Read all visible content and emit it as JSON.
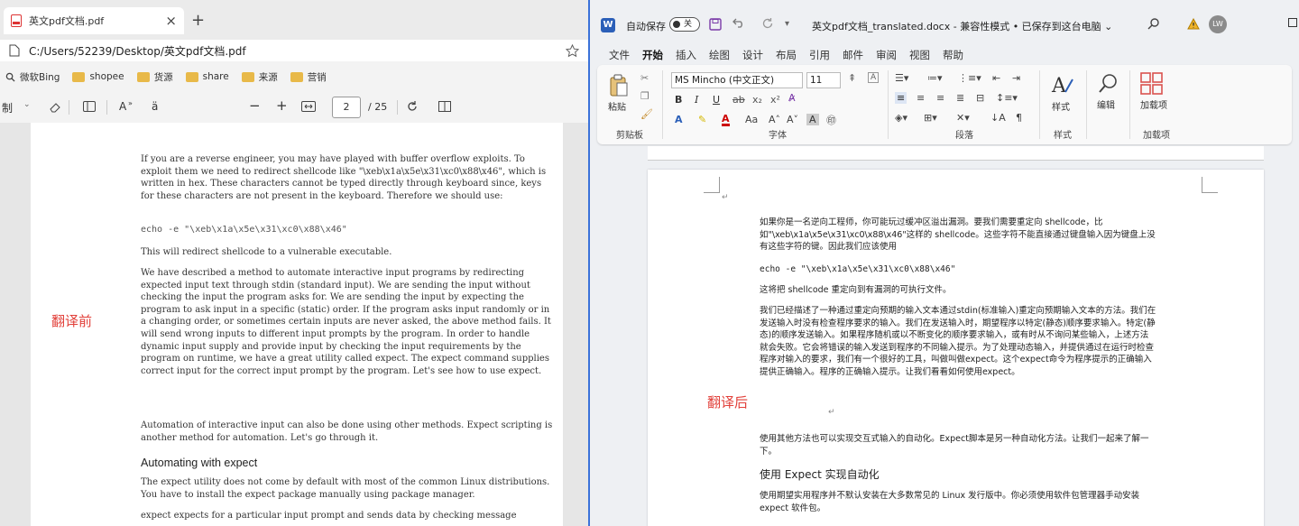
{
  "browser": {
    "tab_title": "英文pdf文档.pdf",
    "close_glyph": "×",
    "newtab_glyph": "+",
    "address": "C:/Users/52239/Desktop/英文pdf文档.pdf",
    "bookmarks": [
      "微软Bing",
      "shopee",
      "货源",
      "share",
      "来源",
      "营销"
    ]
  },
  "pdf_toolbar": {
    "draw_label": "制",
    "read_aloud_label": "A",
    "translate_label": "ä",
    "minus": "−",
    "plus": "+",
    "page_current": "2",
    "page_total": "/ 25"
  },
  "pdf": {
    "paragraphs": [
      "If you are a reverse engineer, you may have played with buffer overflow exploits. To exploit them we need to redirect shellcode like \"\\xeb\\x1a\\x5e\\x31\\xc0\\x88\\x46\", which is written in hex. These characters cannot be typed directly through keyboard since, keys for these characters are not present in the keyboard. Therefore we should use:",
      "echo -e \"\\xeb\\x1a\\x5e\\x31\\xc0\\x88\\x46\"",
      "This will redirect shellcode to a vulnerable executable.",
      "We have described a method to automate interactive input programs by redirecting expected input text through stdin (standard input). We are sending the input without checking the input the program asks for. We are sending the input by expecting the program to ask input in a specific (static) order. If the program asks input randomly or in a changing order, or sometimes certain inputs are never asked, the above method fails. It will send wrong inputs to different input prompts by the program. In order to handle dynamic input supply and provide input by checking the input requirements by the program on runtime, we have a great utility called expect. The expect command supplies correct input for the correct input prompt by the program. Let's see how to use expect.",
      "Automation of interactive input can also be done using other methods. Expect scripting is another method for automation. Let's go through it.",
      "Automating with expect",
      "The expect utility does not come by default with most of the common Linux distributions. You have to install the expect package manually using package manager.",
      "expect expects for a particular input prompt and sends data by checking message"
    ],
    "before_label": "翻译前"
  },
  "word": {
    "logo": "W",
    "autosave_label": "自动保存",
    "autosave_state": "关",
    "doc_title": "英文pdf文档_translated.docx  -  兼容性模式 • 已保存到这台电脑 ⌄",
    "user_initials": "LW",
    "menus": [
      "文件",
      "开始",
      "插入",
      "绘图",
      "设计",
      "布局",
      "引用",
      "邮件",
      "审阅",
      "视图",
      "帮助"
    ],
    "ribbon": {
      "paste_label": "粘贴",
      "clipboard_label": "剪贴板",
      "font_name": "MS Mincho (中文正文)",
      "font_size": "11",
      "font_label": "字体",
      "paragraph_label": "段落",
      "style_button": "样式",
      "styles_label": "样式",
      "edit_button": "编辑",
      "addin_button": "加载项",
      "addins_label": "加载项"
    },
    "paragraphs": [
      "如果你是一名逆向工程师，你可能玩过缓冲区溢出漏洞。要我们需要重定向 shellcode，比如\"\\xeb\\x1a\\x5e\\x31\\xc0\\x88\\x46\"这样的 shellcode。这些字符不能直接通过键盘输入因为键盘上没有这些字符的键。因此我们应该使用",
      "echo -e \"\\xeb\\x1a\\x5e\\x31\\xc0\\x88\\x46\"",
      "这将把 shellcode 重定向到有漏洞的可执行文件。",
      "我们已经描述了一种通过重定向预期的输入文本通过stdin(标准输入)重定向预期输入文本的方法。我们在发送输入时没有检查程序要求的输入。我们在发送输入时，期望程序以特定(静态)顺序要求输入。特定(静态)的顺序发送输入。如果程序随机或以不断变化的顺序要求输入，或有时从不询问某些输入，上述方法就会失败。它会将错误的输入发送到程序的不同输入提示。为了处理动态输入，并提供通过在运行时检查程序对输入的要求，我们有一个很好的工具，叫做叫做expect。这个expect命令为程序提示的正确输入提供正确输入。程序的正确输入提示。让我们看看如何使用expect。",
      "使用其他方法也可以实现交互式输入的自动化。Expect脚本是另一种自动化方法。让我们一起来了解一下。",
      "使用 Expect 实现自动化",
      "使用期望实用程序并不默认安装在大多数常见的 Linux 发行版中。你必须使用软件包管理器手动安装 expect 软件包。"
    ],
    "after_label": "翻译后"
  }
}
